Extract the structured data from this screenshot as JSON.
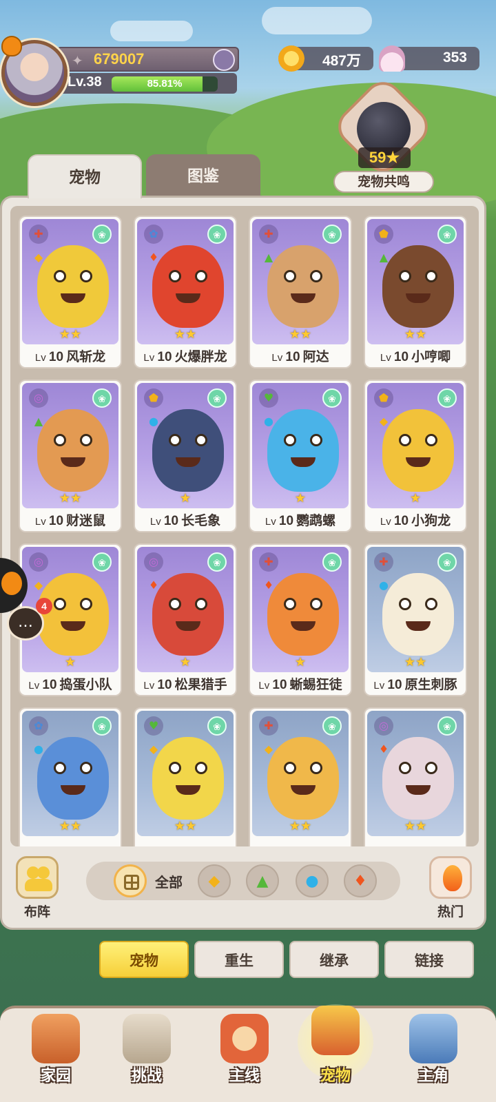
{
  "player": {
    "power": "679007",
    "level": "Lv.38",
    "exp_percent": "85.81%",
    "exp_fraction": 0.8581
  },
  "currency": {
    "gold": "487万",
    "shells": "353"
  },
  "resonance": {
    "stars": "59★",
    "label": "宠物共鸣"
  },
  "tabs": {
    "pets": "宠物",
    "codex": "图鉴"
  },
  "cards": [
    {
      "lv_prefix": "Lv",
      "lv": "10",
      "name": "风斩龙",
      "stars": "★★",
      "bg": "purple",
      "role_icon": "axe-icon",
      "elem_icon": "earth-icon",
      "body_color": "#f0c93a"
    },
    {
      "lv_prefix": "Lv",
      "lv": "10",
      "name": "火爆胖龙",
      "stars": "★★",
      "bg": "purple",
      "role_icon": "key-icon",
      "elem_icon": "fire-icon",
      "body_color": "#e0452e"
    },
    {
      "lv_prefix": "Lv",
      "lv": "10",
      "name": "阿达",
      "stars": "★★",
      "bg": "purple",
      "role_icon": "axe-icon",
      "elem_icon": "grass-icon",
      "body_color": "#d8a26c"
    },
    {
      "lv_prefix": "Lv",
      "lv": "10",
      "name": "小哼唧",
      "stars": "★★",
      "bg": "purple",
      "role_icon": "shield-icon",
      "elem_icon": "grass-icon",
      "body_color": "#7a4a2e"
    },
    {
      "lv_prefix": "Lv",
      "lv": "10",
      "name": "财迷鼠",
      "stars": "★★",
      "bg": "purple",
      "role_icon": "swirl-icon",
      "elem_icon": "grass-icon",
      "body_color": "#e39a52"
    },
    {
      "lv_prefix": "Lv",
      "lv": "10",
      "name": "长毛象",
      "stars": "★",
      "bg": "purple",
      "role_icon": "shield-icon",
      "elem_icon": "water-icon",
      "body_color": "#3f4f7a"
    },
    {
      "lv_prefix": "Lv",
      "lv": "10",
      "name": "鹦鹉螺",
      "stars": "★",
      "bg": "purple",
      "role_icon": "heart-icon",
      "elem_icon": "water-icon",
      "body_color": "#4ab3e8"
    },
    {
      "lv_prefix": "Lv",
      "lv": "10",
      "name": "小狗龙",
      "stars": "★",
      "bg": "purple",
      "role_icon": "shield-icon",
      "elem_icon": "earth-icon",
      "body_color": "#f2c23a"
    },
    {
      "lv_prefix": "Lv",
      "lv": "10",
      "name": "捣蛋小队",
      "stars": "★",
      "bg": "purple",
      "role_icon": "swirl-icon",
      "elem_icon": "earth-icon",
      "body_color": "#f3c13a"
    },
    {
      "lv_prefix": "Lv",
      "lv": "10",
      "name": "松果猎手",
      "stars": "★",
      "bg": "purple",
      "role_icon": "swirl-icon",
      "elem_icon": "fire-icon",
      "body_color": "#d84a3a"
    },
    {
      "lv_prefix": "Lv",
      "lv": "10",
      "name": "蜥蜴狂徒",
      "stars": "★",
      "bg": "purple",
      "role_icon": "axe-icon",
      "elem_icon": "fire-icon",
      "body_color": "#ef8a3a"
    },
    {
      "lv_prefix": "Lv",
      "lv": "10",
      "name": "原生刺豚",
      "stars": "★★",
      "bg": "blue",
      "role_icon": "axe-icon",
      "elem_icon": "water-icon",
      "body_color": "#f5ecd8"
    },
    {
      "lv_prefix": "",
      "lv": "",
      "name": "",
      "stars": "★★",
      "bg": "blue",
      "role_icon": "key-icon",
      "elem_icon": "water-icon",
      "body_color": "#5a8fd8"
    },
    {
      "lv_prefix": "",
      "lv": "",
      "name": "",
      "stars": "★★",
      "bg": "blue",
      "role_icon": "heart-icon",
      "elem_icon": "earth-icon",
      "body_color": "#f2d64a"
    },
    {
      "lv_prefix": "",
      "lv": "",
      "name": "",
      "stars": "★★",
      "bg": "blue",
      "role_icon": "axe-icon",
      "elem_icon": "earth-icon",
      "body_color": "#f0b84a"
    },
    {
      "lv_prefix": "",
      "lv": "",
      "name": "",
      "stars": "★★",
      "bg": "blue",
      "role_icon": "swirl-icon",
      "elem_icon": "fire-icon",
      "body_color": "#e8d6dc"
    }
  ],
  "filters": {
    "formation_label": "布阵",
    "all_label": "全部",
    "hot_label": "热门"
  },
  "chat": {
    "count": "4"
  },
  "subtabs": [
    "宠物",
    "重生",
    "继承",
    "链接"
  ],
  "nav": [
    "家园",
    "挑战",
    "主线",
    "宠物",
    "主角"
  ],
  "colors": {
    "accent_yellow": "#f6cf39",
    "paw_badge": "#6fd6a8",
    "star": "#ffc92e"
  }
}
